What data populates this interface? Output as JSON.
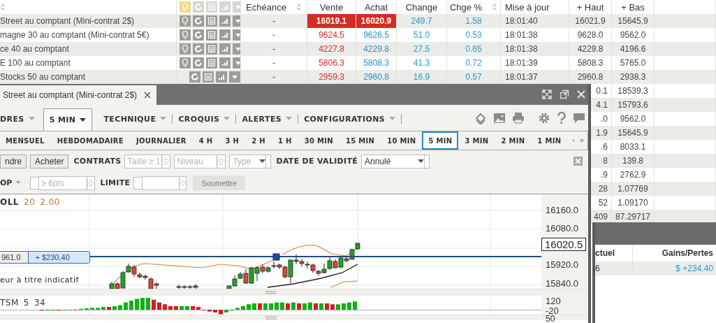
{
  "table": {
    "name_column": {
      "sortable": true
    },
    "header_icons": [
      {
        "kind": "bulb",
        "active": true
      },
      {
        "kind": "refresh",
        "active": false
      },
      {
        "kind": "list",
        "active": false
      },
      {
        "kind": "chart",
        "active": false
      },
      {
        "kind": "dropdown",
        "active": false
      }
    ],
    "columns": [
      {
        "label": "Echéance",
        "sortable": true
      },
      {
        "label": "Vente",
        "sortable": false
      },
      {
        "label": "Achat",
        "sortable": false
      },
      {
        "label": "Change",
        "sortable": false
      },
      {
        "label": "Chge %",
        "sortable": true
      },
      {
        "label": "Mise à jour",
        "sortable": false
      },
      {
        "label": "+ Haut",
        "sortable": false
      },
      {
        "label": "+ Bas",
        "sortable": false
      }
    ],
    "rows": [
      {
        "name": "Street au comptant (Mini-contrat 2$)",
        "alert": true,
        "expiry": "-",
        "sell": "16019.1",
        "buy": "16020.9",
        "change": "249.7",
        "change_pct": "1.58",
        "updated": "18:01:40",
        "high": "16021.9",
        "low": "15645.9",
        "highlighted": true
      },
      {
        "name": "magne 30 au comptant (Mini-contrat 5€)",
        "alert": true,
        "expiry": "-",
        "sell": "9624.5",
        "buy": "9626.5",
        "change": "51.0",
        "change_pct": "0.53",
        "updated": "18:01:38",
        "high": "9628.0",
        "low": "9562.0",
        "highlighted": false
      },
      {
        "name": "ce 40 au comptant",
        "alert": true,
        "expiry": "-",
        "sell": "4227.8",
        "buy": "4229.8",
        "change": "27.5",
        "change_pct": "0.65",
        "updated": "18:01:38",
        "high": "4229.8",
        "low": "4196.6",
        "highlighted": false
      },
      {
        "name": "E 100 au comptant",
        "alert": true,
        "expiry": "-",
        "sell": "5806.3",
        "buy": "5808.3",
        "change": "41.3",
        "change_pct": "0.72",
        "updated": "18:01:39",
        "high": "5808.3",
        "low": "5765.0",
        "highlighted": false
      },
      {
        "name": "Stocks 50 au comptant",
        "alert": false,
        "expiry": "-",
        "sell": "2959.3",
        "buy": "2960.8",
        "change": "16.9",
        "change_pct": "0.57",
        "updated": "18:01:37",
        "high": "2960.8",
        "low": "2938.3",
        "highlighted": false
      }
    ],
    "rows_behind_window": [
      {
        "high": "0.1",
        "low": "18539.3"
      },
      {
        "high": "4.1",
        "low": "15793.6"
      },
      {
        "high": ".0",
        "low": "9562.0"
      },
      {
        "high": "1.9",
        "low": "15645.9"
      },
      {
        "high": ".6",
        "low": "8033.1"
      },
      {
        "high": "8",
        "low": "139.8"
      },
      {
        "high": ".9",
        "low": "2762.9"
      },
      {
        "high": "28",
        "low": "1.07769"
      },
      {
        "high": "52",
        "low": "1.09170"
      },
      {
        "high": "409",
        "low": "87.29717"
      }
    ]
  },
  "chart_window": {
    "title": "Street au comptant (Mini-contrat 2$)",
    "menu": [
      {
        "label": "DRES",
        "selected": false
      },
      {
        "label": "5 MIN",
        "selected": true
      },
      {
        "label": "TECHNIQUE",
        "selected": false
      },
      {
        "label": "CROQUIS",
        "selected": false
      },
      {
        "label": "ALERTES",
        "selected": false
      },
      {
        "label": "CONFIGURATIONS",
        "selected": false
      }
    ],
    "periods": [
      {
        "label": "MENSUEL",
        "selected": false
      },
      {
        "label": "HEBDOMADAIRE",
        "selected": false
      },
      {
        "label": "JOURNALIER",
        "selected": false
      },
      {
        "label": "4 H",
        "selected": false
      },
      {
        "label": "3 H",
        "selected": false
      },
      {
        "label": "2 H",
        "selected": false
      },
      {
        "label": "1 H",
        "selected": false
      },
      {
        "label": "30 MIN",
        "selected": false
      },
      {
        "label": "15 MIN",
        "selected": false
      },
      {
        "label": "10 MIN",
        "selected": false
      },
      {
        "label": "5 MIN",
        "selected": true
      },
      {
        "label": "3 MIN",
        "selected": false
      },
      {
        "label": "2 MIN",
        "selected": false
      },
      {
        "label": "1 MIN",
        "selected": false
      }
    ],
    "order_form": {
      "sell_button": "ndre",
      "buy_button": "Acheter",
      "contracts_label": "CONTRATS",
      "size_placeholder": "Taille ≥ 1",
      "level_placeholder": "Niveau",
      "type_placeholder": "Type",
      "validity_label": "DATE DE VALIDITÉ",
      "validity_value": "Annulé",
      "stop_label": "OP",
      "stop_checked": false,
      "stop_placeholder": "≥ 6pts",
      "limit_label": "LIMITE",
      "limit_checked": false,
      "submit": "Soumettre",
      "submit_disabled": true
    },
    "chart": {
      "legend_name": "OLL",
      "legend_params": [
        "20",
        "2.00"
      ],
      "position_price": "961.0",
      "position_pnl": "+ $230,40",
      "note": "eur à titre indicatif",
      "y_labels": [
        "16160.0",
        "16080.0",
        "15920.0",
        "15840.0"
      ],
      "current_price": "16020.5",
      "indicator_name": "TSM",
      "indicator_params": [
        "5",
        "34"
      ],
      "indicator_labels": [
        "120",
        "-20"
      ],
      "next_label": "50"
    }
  },
  "positions_panel": {
    "columns": [
      "ctuel",
      "Gains/Pertes"
    ],
    "row": [
      "6",
      "$ +234.40"
    ]
  }
}
